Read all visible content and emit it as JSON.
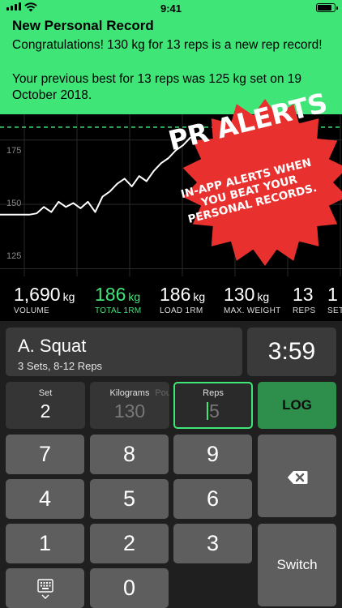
{
  "status_bar": {
    "time": "9:41"
  },
  "notification": {
    "title": "New Personal Record",
    "message": "Congratulations! 130 kg for 13 reps is a new rep record!",
    "detail": "Your previous best for 13 reps was 125 kg set on 19 October 2018."
  },
  "chart_data": {
    "type": "line",
    "y_tick_labels": [
      "175",
      "150",
      "125"
    ],
    "ylim": [
      122,
      185
    ],
    "x": [
      0,
      1,
      2,
      3,
      4,
      5,
      6,
      7,
      8,
      9,
      10,
      11,
      12,
      13,
      14,
      15,
      16,
      17,
      18,
      19,
      20,
      21,
      22,
      23,
      24,
      25,
      26
    ],
    "series": [
      {
        "values": [
          146,
          146,
          146,
          146,
          146,
          146.5,
          149,
          147,
          151,
          149,
          150.5,
          148.5,
          151,
          147,
          153,
          155,
          158,
          160,
          157,
          161,
          159,
          163,
          166,
          168,
          171,
          173,
          176
        ]
      }
    ],
    "reference_line": 180,
    "grid": true,
    "colors": {
      "line": "#ffffff",
      "reference": "#3fe677"
    }
  },
  "promo_badge": {
    "title": "PR ALERTS",
    "body": "IN-APP ALERTS WHEN YOU BEAT YOUR PERSONAL RECORDS.",
    "color": "#e8312f"
  },
  "stats": [
    {
      "value": "1,690",
      "unit": "kg",
      "label": "VOLUME"
    },
    {
      "value": "186",
      "unit": "kg",
      "label": "TOTAL 1RM",
      "highlight": true
    },
    {
      "value": "186",
      "unit": "kg",
      "label": "LOAD 1RM"
    },
    {
      "value": "130",
      "unit": "kg",
      "label": "MAX. WEIGHT"
    },
    {
      "value": "13",
      "unit": "",
      "label": "REPS"
    },
    {
      "value": "1",
      "unit": "",
      "label": "SET"
    }
  ],
  "exercise": {
    "name": "A. Squat",
    "details": "3 Sets, 8-12 Reps"
  },
  "timer": "3:59",
  "fields": {
    "set": {
      "label": "Set",
      "value": "2"
    },
    "weight": {
      "label": "Kilograms",
      "value": "130",
      "unit_hint": "Pou"
    },
    "reps": {
      "label": "Reps",
      "value": "5"
    }
  },
  "buttons": {
    "log": "LOG",
    "switch": "Switch"
  },
  "keypad": [
    "7",
    "8",
    "9",
    "4",
    "5",
    "6",
    "1",
    "2",
    "3",
    "0"
  ],
  "icons": {
    "backspace": "backspace-icon",
    "keyboard": "keyboard-hide-icon"
  },
  "colors": {
    "accent": "#3fe677",
    "banner": "#3fe677",
    "log_button": "#2e8f4d",
    "key": "#5e5e5e"
  }
}
